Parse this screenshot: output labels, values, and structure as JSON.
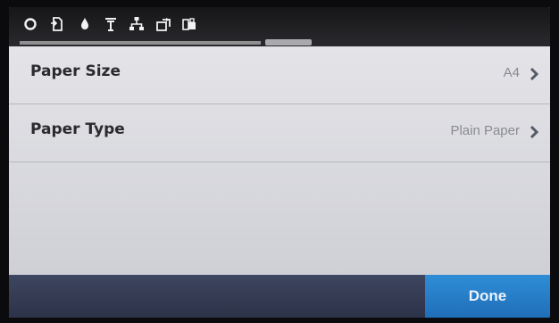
{
  "top_bar": {
    "icons": [
      "setup-gear-icon",
      "document-icon",
      "ink-drop-icon",
      "wireless-signal-icon",
      "network-icon",
      "web-services-icon",
      "printer-apps-icon"
    ]
  },
  "settings": {
    "rows": [
      {
        "label": "Paper Size",
        "value": "A4"
      },
      {
        "label": "Paper Type",
        "value": "Plain Paper"
      }
    ]
  },
  "bottom_bar": {
    "done_label": "Done"
  },
  "colors": {
    "top_bar": "#1f1f22",
    "list_background": "#dcdce1",
    "bottom_bar": "#343a52",
    "done_button": "#2680c8"
  }
}
